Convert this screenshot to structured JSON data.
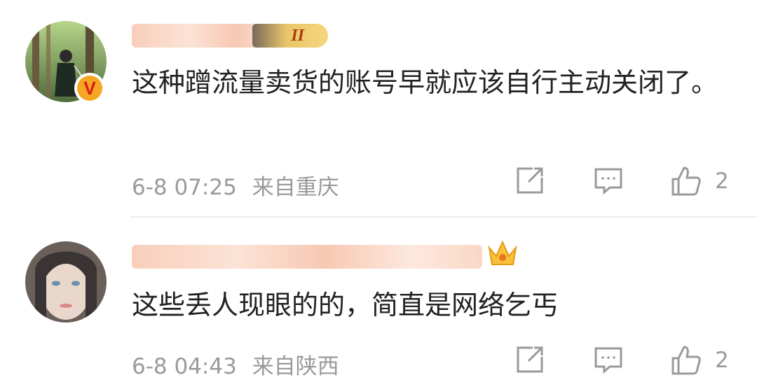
{
  "comments": [
    {
      "text": "这种蹭流量卖货的账号早就应该自行主动关闭了。",
      "date": "6-8 07:25",
      "location": "来自重庆",
      "likes": "2",
      "level_badge": "II",
      "verified_badge": "V",
      "avatar_icon": "avatar-swordsman-forest"
    },
    {
      "text": "这些丢人现眼的的，简直是网络乞丐",
      "date": "6-8 04:43",
      "location": "来自陕西",
      "likes": "2",
      "avatar_icon": "avatar-woman-portrait"
    }
  ],
  "icons": [
    "share-icon",
    "comment-icon",
    "like-icon",
    "crown-icon",
    "verified-icon"
  ],
  "colors": {
    "meta_gray": "#9a9a9a",
    "text": "#222222",
    "badge_gold": "#f5a623",
    "verified_red": "#e0161c"
  }
}
